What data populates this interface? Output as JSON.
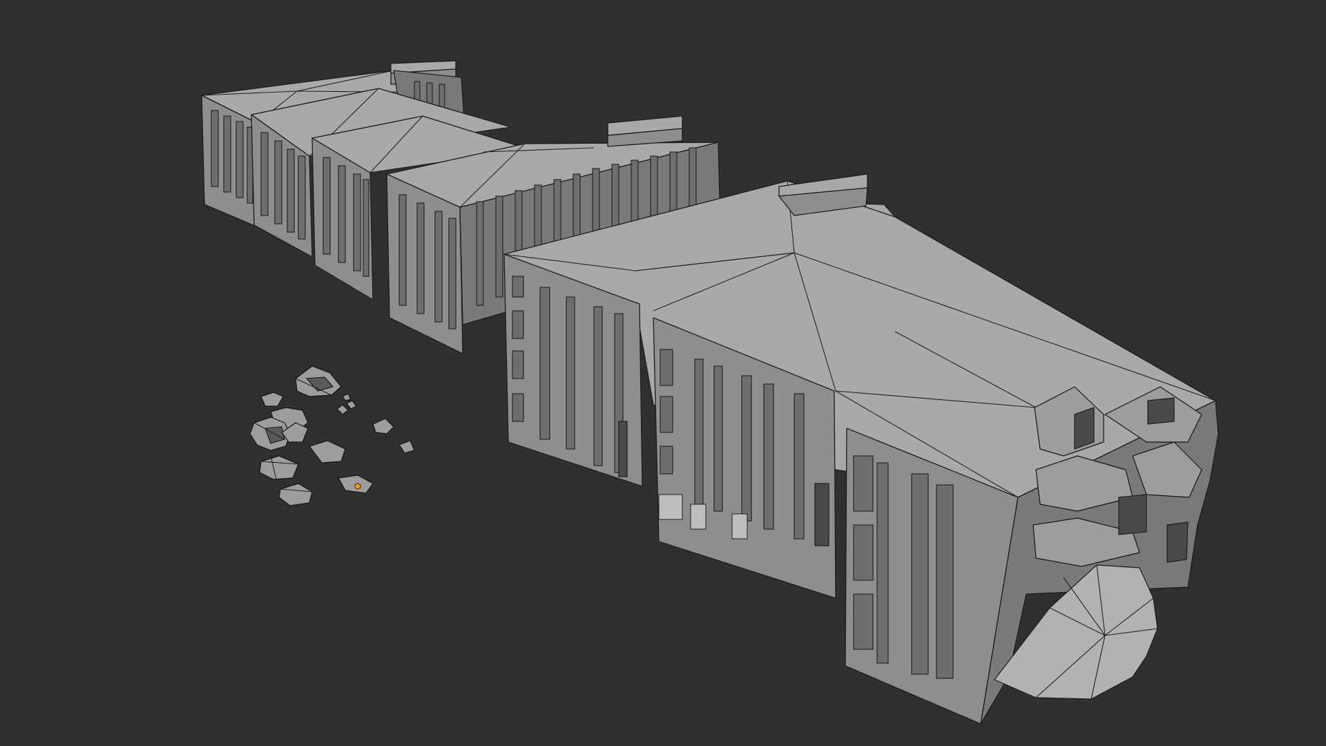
{
  "viewport": {
    "background": "#303030",
    "shading": "solid",
    "overlay": "wireframe"
  },
  "objects": [
    {
      "name": "building-block-1",
      "kind": "apartment building"
    },
    {
      "name": "building-block-2",
      "kind": "apartment building"
    },
    {
      "name": "building-block-3",
      "kind": "apartment building"
    },
    {
      "name": "building-block-4",
      "kind": "apartment building"
    },
    {
      "name": "building-block-5",
      "kind": "apartment building, destroyed end"
    },
    {
      "name": "debris-cluster",
      "kind": "rubble pieces"
    }
  ],
  "colors": {
    "roof": "#a9a9a9",
    "facade": "#8e8e8e",
    "side": "#7a7a7a",
    "edges": "#1c1c1c",
    "selection-origin": "#ff9a1a"
  }
}
